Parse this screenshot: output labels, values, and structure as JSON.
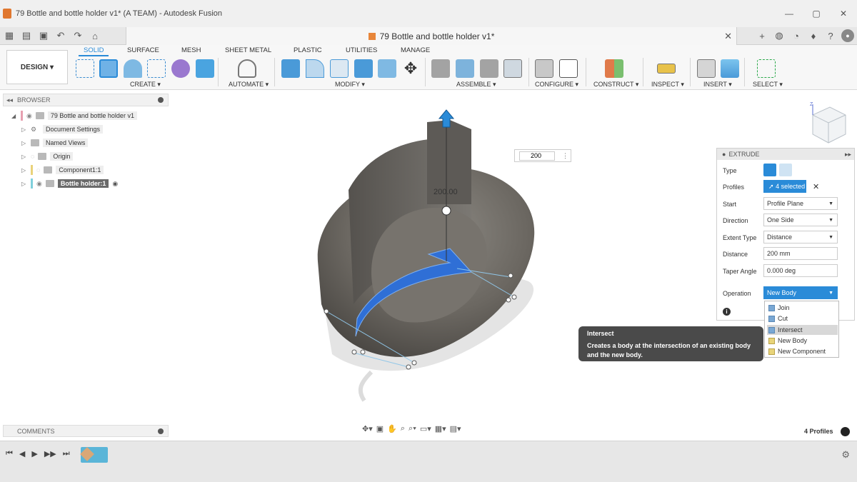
{
  "window": {
    "title": "79 Bottle and bottle holder v1* (A TEAM) - Autodesk Fusion",
    "controls": [
      "✕",
      "▢",
      "—"
    ]
  },
  "doc_tab": {
    "title": "79 Bottle and bottle holder v1*",
    "close": "✕"
  },
  "ribbon": {
    "workspace": "DESIGN",
    "tabs": [
      "SOLID",
      "SURFACE",
      "MESH",
      "SHEET METAL",
      "PLASTIC",
      "UTILITIES",
      "MANAGE"
    ],
    "active_tab": "SOLID",
    "groups": [
      "CREATE",
      "AUTOMATE",
      "MODIFY",
      "ASSEMBLE",
      "CONFIGURE",
      "CONSTRUCT",
      "INSPECT",
      "INSERT",
      "SELECT"
    ]
  },
  "browser": {
    "title": "BROWSER",
    "items": [
      {
        "label": "79 Bottle and bottle holder v1"
      },
      {
        "label": "Document Settings"
      },
      {
        "label": "Named Views"
      },
      {
        "label": "Origin"
      },
      {
        "label": "Component1:1"
      },
      {
        "label": "Bottle holder:1"
      }
    ]
  },
  "viewport": {
    "dimension_input": "200",
    "dimension_label": "200.00"
  },
  "extrude": {
    "title": "EXTRUDE",
    "type_label": "Type",
    "profiles_label": "Profiles",
    "profiles_value": "4 selected",
    "start_label": "Start",
    "start_value": "Profile Plane",
    "direction_label": "Direction",
    "direction_value": "One Side",
    "extent_label": "Extent Type",
    "extent_value": "Distance",
    "distance_label": "Distance",
    "distance_value": "200 mm",
    "taper_label": "Taper Angle",
    "taper_value": "0.000 deg",
    "operation_label": "Operation",
    "operation_value": "New Body"
  },
  "operation_menu": {
    "items": [
      "Join",
      "Cut",
      "Intersect",
      "New Body",
      "New Component"
    ],
    "highlighted": "Intersect"
  },
  "tooltip": {
    "title": "Intersect",
    "body": "Creates a body at the intersection of an existing body and the new body."
  },
  "comments": {
    "title": "COMMENTS"
  },
  "status": {
    "profiles_count": "4 Profiles"
  },
  "colors": {
    "accent": "#2a8bd8",
    "model": "#6b6761",
    "profile": "#2f6fd6"
  }
}
